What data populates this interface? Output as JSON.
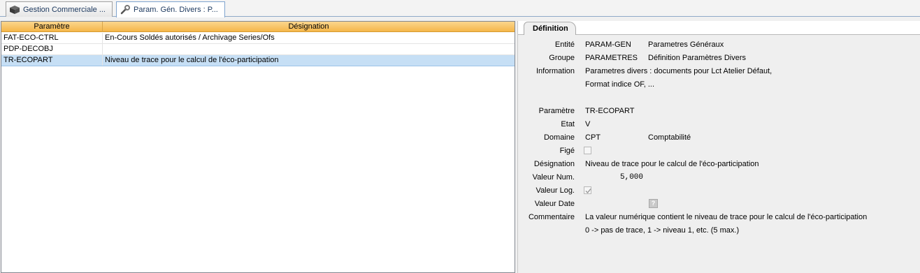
{
  "tabs": [
    {
      "label": "Gestion Commerciale ..."
    },
    {
      "label": "Param. Gén. Divers : P..."
    }
  ],
  "grid": {
    "headers": {
      "param": "Paramètre",
      "designation": "Désignation"
    },
    "rows": [
      {
        "param": "FAT-ECO-CTRL",
        "designation": "En-Cours Soldés autorisés / Archivage Series/Ofs"
      },
      {
        "param": "PDP-DECOBJ",
        "designation": ""
      },
      {
        "param": "TR-ECOPART",
        "designation": "Niveau de trace pour le calcul de l'éco-participation"
      }
    ]
  },
  "definition": {
    "tab_label": "Définition",
    "labels": {
      "entite": "Entité",
      "groupe": "Groupe",
      "information": "Information",
      "parametre": "Paramètre",
      "etat": "Etat",
      "domaine": "Domaine",
      "fige": "Figé",
      "designation": "Désignation",
      "valeur_num": "Valeur Num.",
      "valeur_log": "Valeur Log.",
      "valeur_date": "Valeur Date",
      "commentaire": "Commentaire"
    },
    "entite_code": "PARAM-GEN",
    "entite_name": "Parametres Généraux",
    "groupe_code": "PARAMETRES",
    "groupe_name": "Définition Paramètres Divers",
    "information_line1": "Parametres divers : documents pour Lct Atelier Défaut,",
    "information_line2": "Format indice OF, ...",
    "parametre": "TR-ECOPART",
    "etat": "V",
    "domaine_code": "CPT",
    "domaine_name": "Comptabilité",
    "fige_checked": false,
    "designation": "Niveau de trace pour le calcul de l'éco-participation",
    "valeur_num": "5,000",
    "valeur_log_checked": true,
    "valeur_date_button": "?",
    "commentaire_line1": "La valeur numérique contient le niveau de trace pour le calcul de l'éco-participation",
    "commentaire_line2": "0 -> pas de trace, 1 -> niveau 1, etc. (5 max.)"
  },
  "colors": {
    "header_orange": "#f5b64a",
    "selected_row": "#c6dff5",
    "panel_bg": "#efefef"
  },
  "icons": [
    "cube-icon",
    "wrench-icon",
    "checkbox-icon",
    "question-icon"
  ]
}
